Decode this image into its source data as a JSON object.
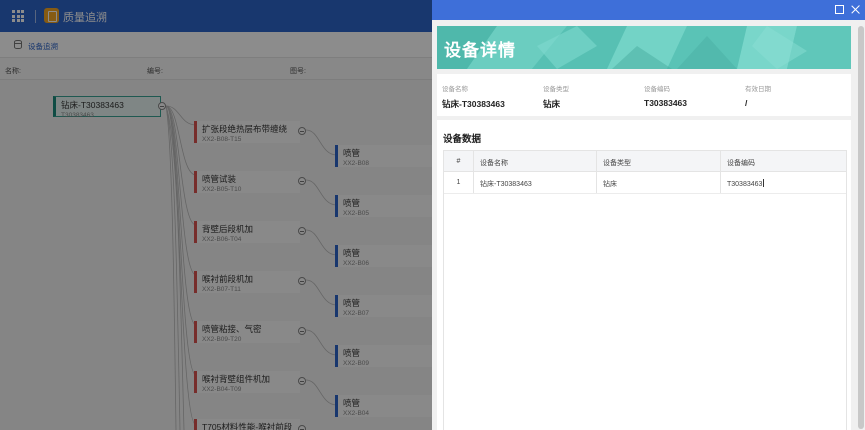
{
  "app": {
    "title": "质量追溯",
    "tab_label": "设备追溯",
    "filters": {
      "name_label": "名称:",
      "code_label": "编号:",
      "drawing_label": "图号:"
    }
  },
  "tree": {
    "root": {
      "title": "钻床-T30383463",
      "sub": "T30383463"
    },
    "level2": [
      {
        "title": "扩张段绝热层布带缠绕",
        "sub": "XX2-B08-T15"
      },
      {
        "title": "喷管试装",
        "sub": "XX2-B05-T10"
      },
      {
        "title": "背壁后段机加",
        "sub": "XX2-B06-T04"
      },
      {
        "title": "喉衬前段机加",
        "sub": "XX2-B07-T11"
      },
      {
        "title": "喷管粘接、气密",
        "sub": "XX2-B09-T20"
      },
      {
        "title": "喉衬背壁组件机加",
        "sub": "XX2-B04-T09"
      },
      {
        "title": "T705材料性能-喉衬前段",
        "sub": ""
      }
    ],
    "level3": [
      {
        "title": "喷管",
        "sub": "XX2-B08"
      },
      {
        "title": "喷管",
        "sub": "XX2-B05"
      },
      {
        "title": "喷管",
        "sub": "XX2-B06"
      },
      {
        "title": "喷管",
        "sub": "XX2-B07"
      },
      {
        "title": "喷管",
        "sub": "XX2-B09"
      },
      {
        "title": "喷管",
        "sub": "XX2-B04"
      }
    ]
  },
  "drawer": {
    "banner_title": "设备详情",
    "info": [
      {
        "label": "设备名称",
        "value": "钻床-T30383463"
      },
      {
        "label": "设备类型",
        "value": "钻床"
      },
      {
        "label": "设备编码",
        "value": "T30383463"
      },
      {
        "label": "有效日期",
        "value": "/"
      }
    ],
    "data_title": "设备数据",
    "table": {
      "headers": [
        "#",
        "设备名称",
        "设备类型",
        "设备编码"
      ],
      "rows": [
        [
          "1",
          "钻床-T30383463",
          "钻床",
          "T30383463"
        ]
      ]
    }
  },
  "colors": {
    "topbar": "#2d64c8",
    "drawer_header": "#3e6fd9",
    "banner": "#5ec5b8",
    "root_accent": "#1d8a7c",
    "process_accent": "#d9534f",
    "part_accent": "#2d64c8"
  }
}
